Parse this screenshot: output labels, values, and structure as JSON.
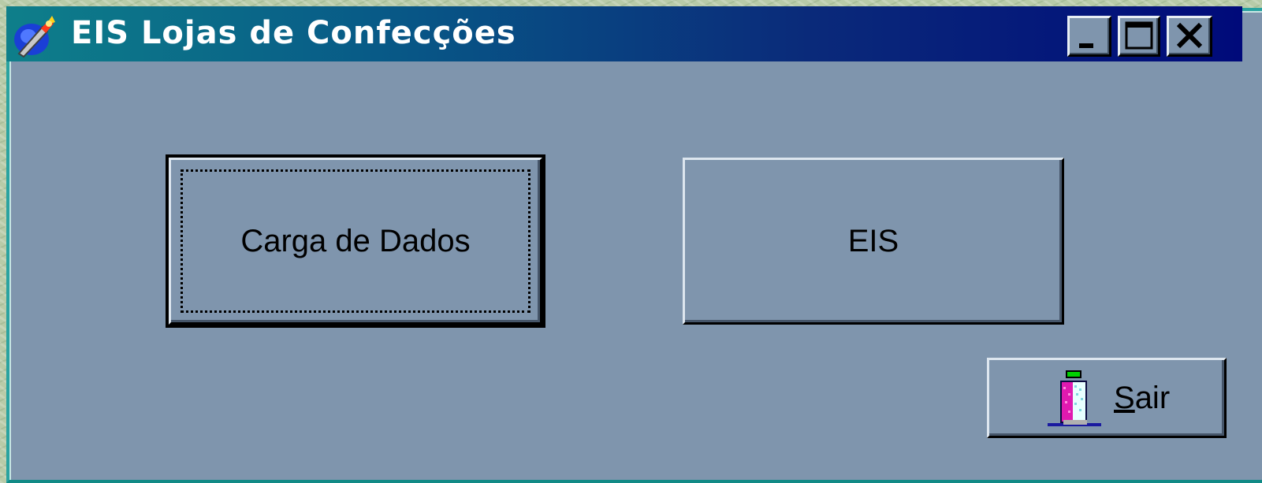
{
  "window": {
    "title": "EIS Lojas de Confecções",
    "controls": {
      "minimize_icon": "minimize-icon",
      "maximize_icon": "maximize-icon",
      "close_icon": "close-icon"
    }
  },
  "buttons": {
    "carga": {
      "label": "Carga de Dados",
      "focused": true
    },
    "eis": {
      "label": "EIS"
    },
    "sair": {
      "mnemonic": "S",
      "rest": "air",
      "icon": "exit-door-icon"
    }
  },
  "colors": {
    "face": "#7f95ad",
    "titlebar_start": "#0e7f8a",
    "titlebar_end": "#000a7a",
    "frame": "#2aa3a0"
  }
}
